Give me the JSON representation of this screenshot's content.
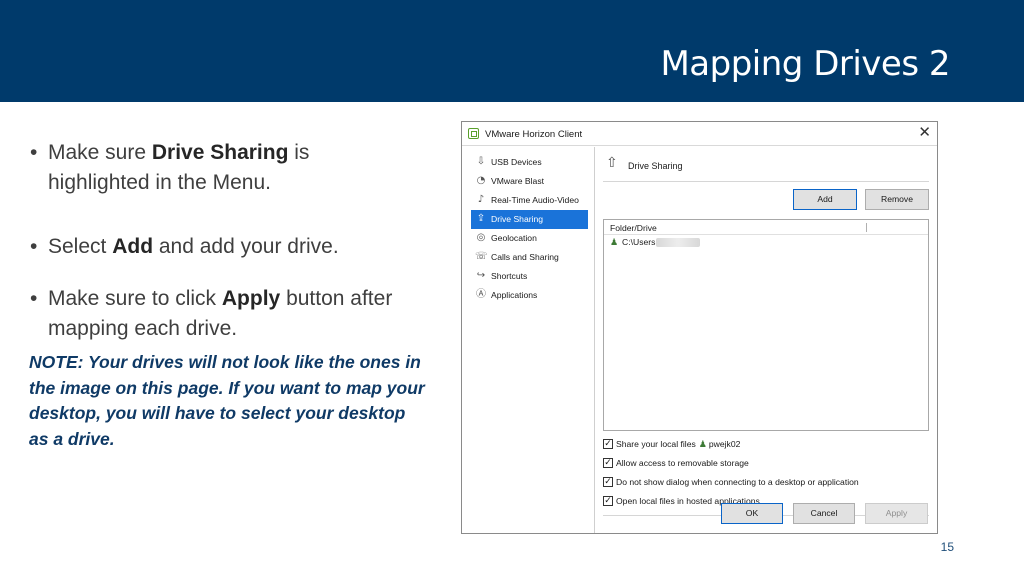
{
  "slide": {
    "title": "Mapping Drives 2",
    "page_number": "15",
    "bullets": [
      {
        "before": "Make sure ",
        "bold": "Drive Sharing",
        "after": " is highlighted in the Menu."
      },
      {
        "before": "Select ",
        "bold": "Add",
        "after": " and add your drive."
      },
      {
        "before": "Make sure to click ",
        "bold": "Apply",
        "after": " button after mapping each drive."
      }
    ],
    "note": "NOTE: Your drives will not look like the ones in the image on this page. If you want to map your desktop, you will have to select your desktop as a drive."
  },
  "dialog": {
    "title": "VMware Horizon Client",
    "close_glyph": "✕",
    "sidebar": {
      "items": [
        {
          "label": "USB Devices",
          "icon": "usb-icon",
          "glyph": "⇩"
        },
        {
          "label": "VMware Blast",
          "icon": "blast-icon",
          "glyph": "◔"
        },
        {
          "label": "Real-Time Audio-Video",
          "icon": "microphone-icon",
          "glyph": "♪"
        },
        {
          "label": "Drive Sharing",
          "icon": "drive-share-icon",
          "glyph": "⇪"
        },
        {
          "label": "Geolocation",
          "icon": "location-icon",
          "glyph": "◎"
        },
        {
          "label": "Calls and Sharing",
          "icon": "phone-icon",
          "glyph": "☏"
        },
        {
          "label": "Shortcuts",
          "icon": "shortcut-icon",
          "glyph": "↪"
        },
        {
          "label": "Applications",
          "icon": "applications-icon",
          "glyph": "Ⓐ"
        }
      ],
      "active_index": 3
    },
    "section_title": "Drive Sharing",
    "section_icon_glyph": "⇧",
    "buttons": {
      "add": "Add",
      "remove": "Remove",
      "ok": "OK",
      "cancel": "Cancel",
      "apply": "Apply"
    },
    "list": {
      "header": "Folder/Drive",
      "rows": [
        {
          "path": "C:\\Users",
          "user_glyph": "♟"
        }
      ]
    },
    "checkboxes": [
      {
        "label": "Share your local files",
        "extra": "pwejk02",
        "checked": true
      },
      {
        "label": "Allow access to removable storage",
        "checked": true
      },
      {
        "label": "Do not show dialog when connecting to a desktop or application",
        "checked": true
      },
      {
        "label": "Open local files in hosted applications",
        "checked": true
      }
    ],
    "check_glyph": "✓",
    "share_glyph": "♟"
  }
}
